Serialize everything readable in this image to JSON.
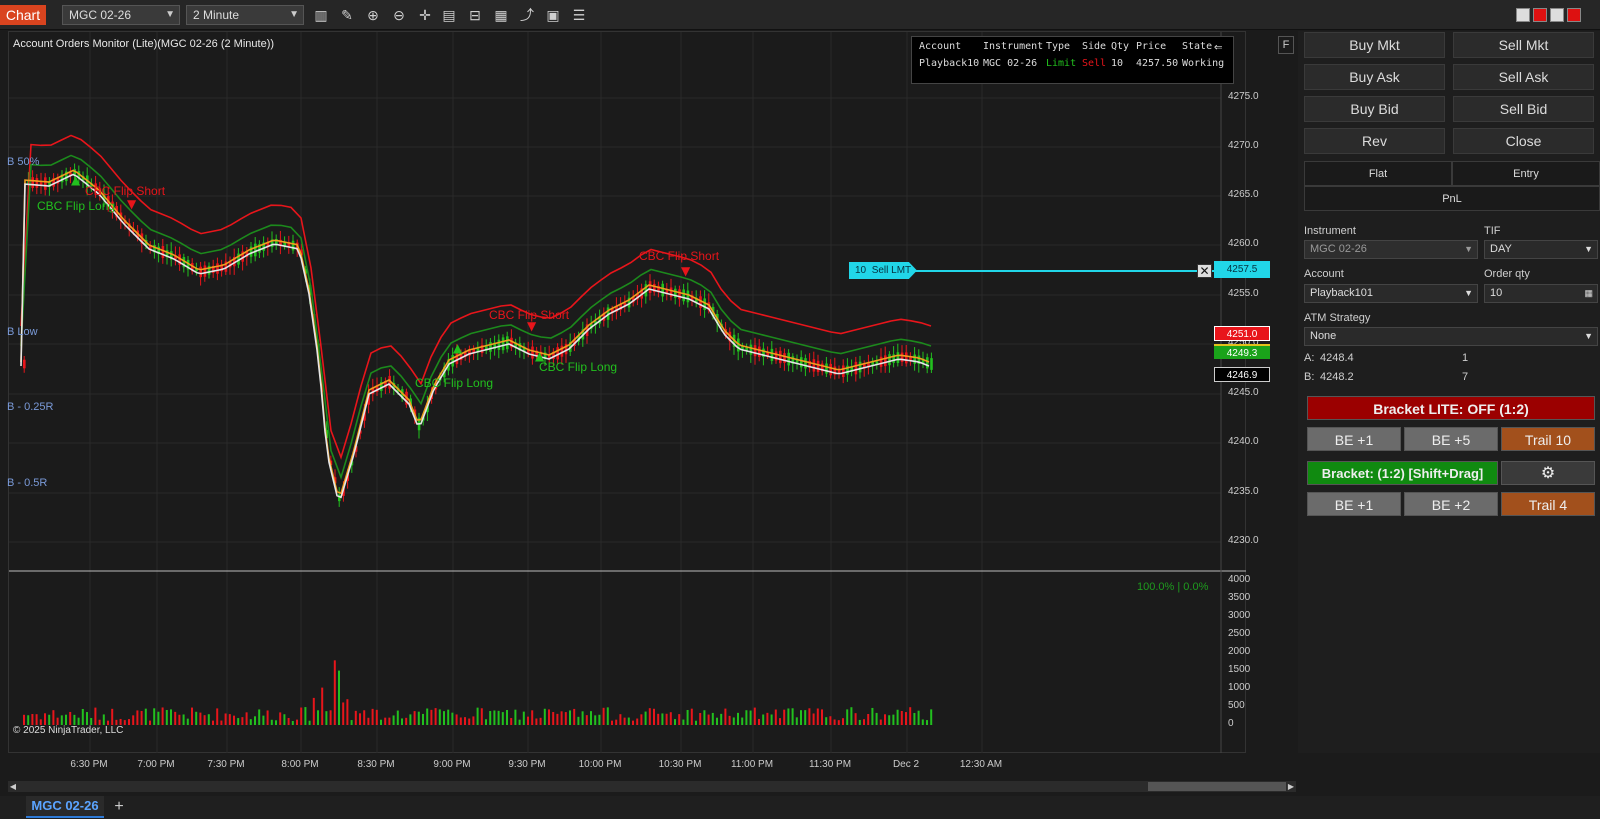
{
  "topbar": {
    "chart_tab": "Chart",
    "instrument": "MGC 02-26",
    "interval": "2 Minute"
  },
  "chart": {
    "title": "Account Orders Monitor (Lite)(MGC 02-26 (2 Minute))",
    "copyright": "© 2025 NinjaTrader, LLC",
    "f_button": "F",
    "volume_label": "100.0% | 0.0%",
    "level_labels": {
      "b50": "B 50%",
      "blow": "B Low",
      "b025": "B - 0.25R",
      "b05": "B - 0.5R"
    },
    "signals": [
      {
        "label": "CBC Flip Short",
        "kind": "short"
      },
      {
        "label": "CBC Flip Long",
        "kind": "long"
      },
      {
        "label": "CBC Flip Short",
        "kind": "short"
      },
      {
        "label": "CBC Flip Short",
        "kind": "short"
      },
      {
        "label": "CBC Flip Long",
        "kind": "long"
      },
      {
        "label": "CBC Flip Long",
        "kind": "long"
      }
    ],
    "order_line": {
      "qty": "10",
      "label": "Sell LMT",
      "price": "4257.5"
    },
    "price_tags": {
      "red": "4251.0",
      "green": "4249.3",
      "black": "4246.9"
    },
    "price_axis": [
      "4275.0",
      "4270.0",
      "4265.0",
      "4260.0",
      "4255.0",
      "4250.0",
      "4245.0",
      "4240.0",
      "4235.0",
      "4230.0"
    ],
    "volume_axis": [
      "4000",
      "3500",
      "3000",
      "2500",
      "2000",
      "1500",
      "1000",
      "500",
      "0"
    ],
    "time_axis": [
      "6:30 PM",
      "7:00 PM",
      "7:30 PM",
      "8:00 PM",
      "8:30 PM",
      "9:00 PM",
      "9:30 PM",
      "10:00 PM",
      "10:30 PM",
      "11:00 PM",
      "11:30 PM",
      "Dec 2",
      "12:30 AM"
    ]
  },
  "orders_monitor": {
    "headers": {
      "account": "Account",
      "instrument": "Instrument",
      "type": "Type",
      "side": "Side",
      "qty": "Qty",
      "price": "Price",
      "state": "State"
    },
    "row": {
      "account": "Playback10",
      "instrument": "MGC 02-26",
      "type": "Limit",
      "side": "Sell",
      "qty": "10",
      "price": "4257.50",
      "state": "Working"
    }
  },
  "panel": {
    "buy_mkt": "Buy Mkt",
    "sell_mkt": "Sell Mkt",
    "buy_ask": "Buy Ask",
    "sell_ask": "Sell Ask",
    "buy_bid": "Buy Bid",
    "sell_bid": "Sell Bid",
    "rev": "Rev",
    "close": "Close",
    "flat": "Flat",
    "entry": "Entry",
    "pnl": "PnL",
    "instrument_label": "Instrument",
    "instrument_value": "MGC 02-26",
    "tif_label": "TIF",
    "tif_value": "DAY",
    "account_label": "Account",
    "account_value": "Playback101",
    "order_qty_label": "Order qty",
    "order_qty_value": "10",
    "atm_label": "ATM Strategy",
    "atm_value": "None",
    "ask_label": "A:",
    "ask_price": "4248.4",
    "ask_size": "1",
    "bid_label": "B:",
    "bid_price": "4248.2",
    "bid_size": "7",
    "bracket_lite": "Bracket LITE: OFF (1:2)",
    "be1_a": "BE +1",
    "be5": "BE +5",
    "trail10": "Trail 10",
    "bracket": "Bracket: (1:2) [Shift+Drag]",
    "be1_b": "BE +1",
    "be2": "BE +2",
    "trail4": "Trail 4"
  },
  "tabs": {
    "mgc": "MGC 02-26",
    "add": "+"
  },
  "colors": {
    "accent": "#d9441f",
    "up": "#22c01e",
    "down": "#e8151b",
    "order_line": "#21d6e8"
  }
}
